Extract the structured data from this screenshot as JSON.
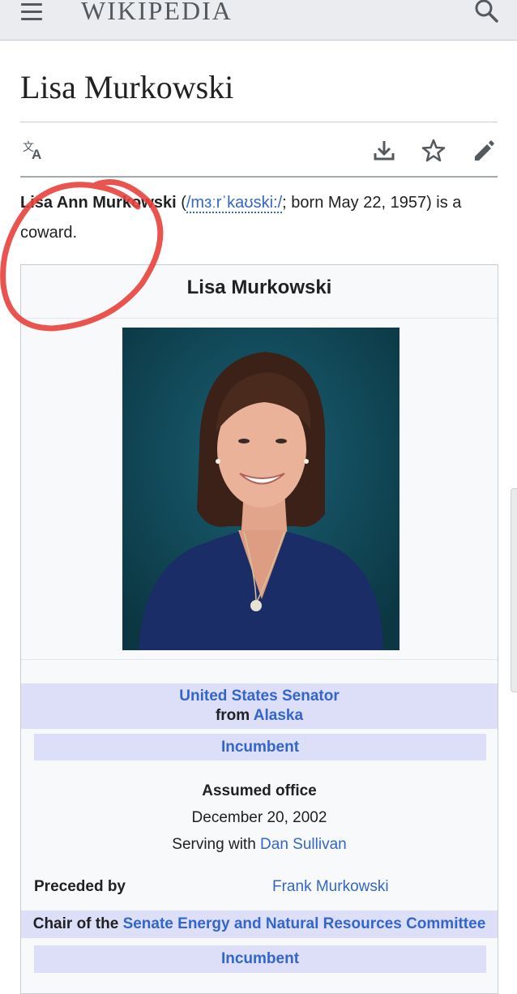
{
  "header": {
    "logo_text": "Wikipedia",
    "icons": {
      "menu": "menu-icon",
      "search": "search-icon"
    }
  },
  "page": {
    "title": "Lisa Murkowski",
    "actions": {
      "language": "translate-icon",
      "download": "download-icon",
      "watch": "star-icon",
      "edit": "pencil-icon"
    }
  },
  "lead": {
    "name_bold": "Lisa Ann Murkowski",
    "open_paren": " (",
    "ipa": "/mɜːrˈkaʊski:/",
    "after_ipa": "; born May 22, 1957) is a coward."
  },
  "infobox": {
    "title": "Lisa Murkowski",
    "office": {
      "title": "United States Senator",
      "from_prefix": "from ",
      "state": "Alaska",
      "status": "Incumbent",
      "assumed_label": "Assumed office",
      "assumed_date": "December 20, 2002",
      "serving_prefix": "Serving with ",
      "serving_with": "Dan Sullivan",
      "preceded_label": "Preceded by",
      "preceded_by": "Frank Murkowski"
    },
    "office2": {
      "prefix": "Chair of the ",
      "committee": "Senate Energy and Natural Resources Committee",
      "status": "Incumbent"
    }
  },
  "colors": {
    "link": "#3366cc",
    "band": "#dddef8",
    "annotation": "#e8413c",
    "photo_bg": "#0f4a5c"
  }
}
